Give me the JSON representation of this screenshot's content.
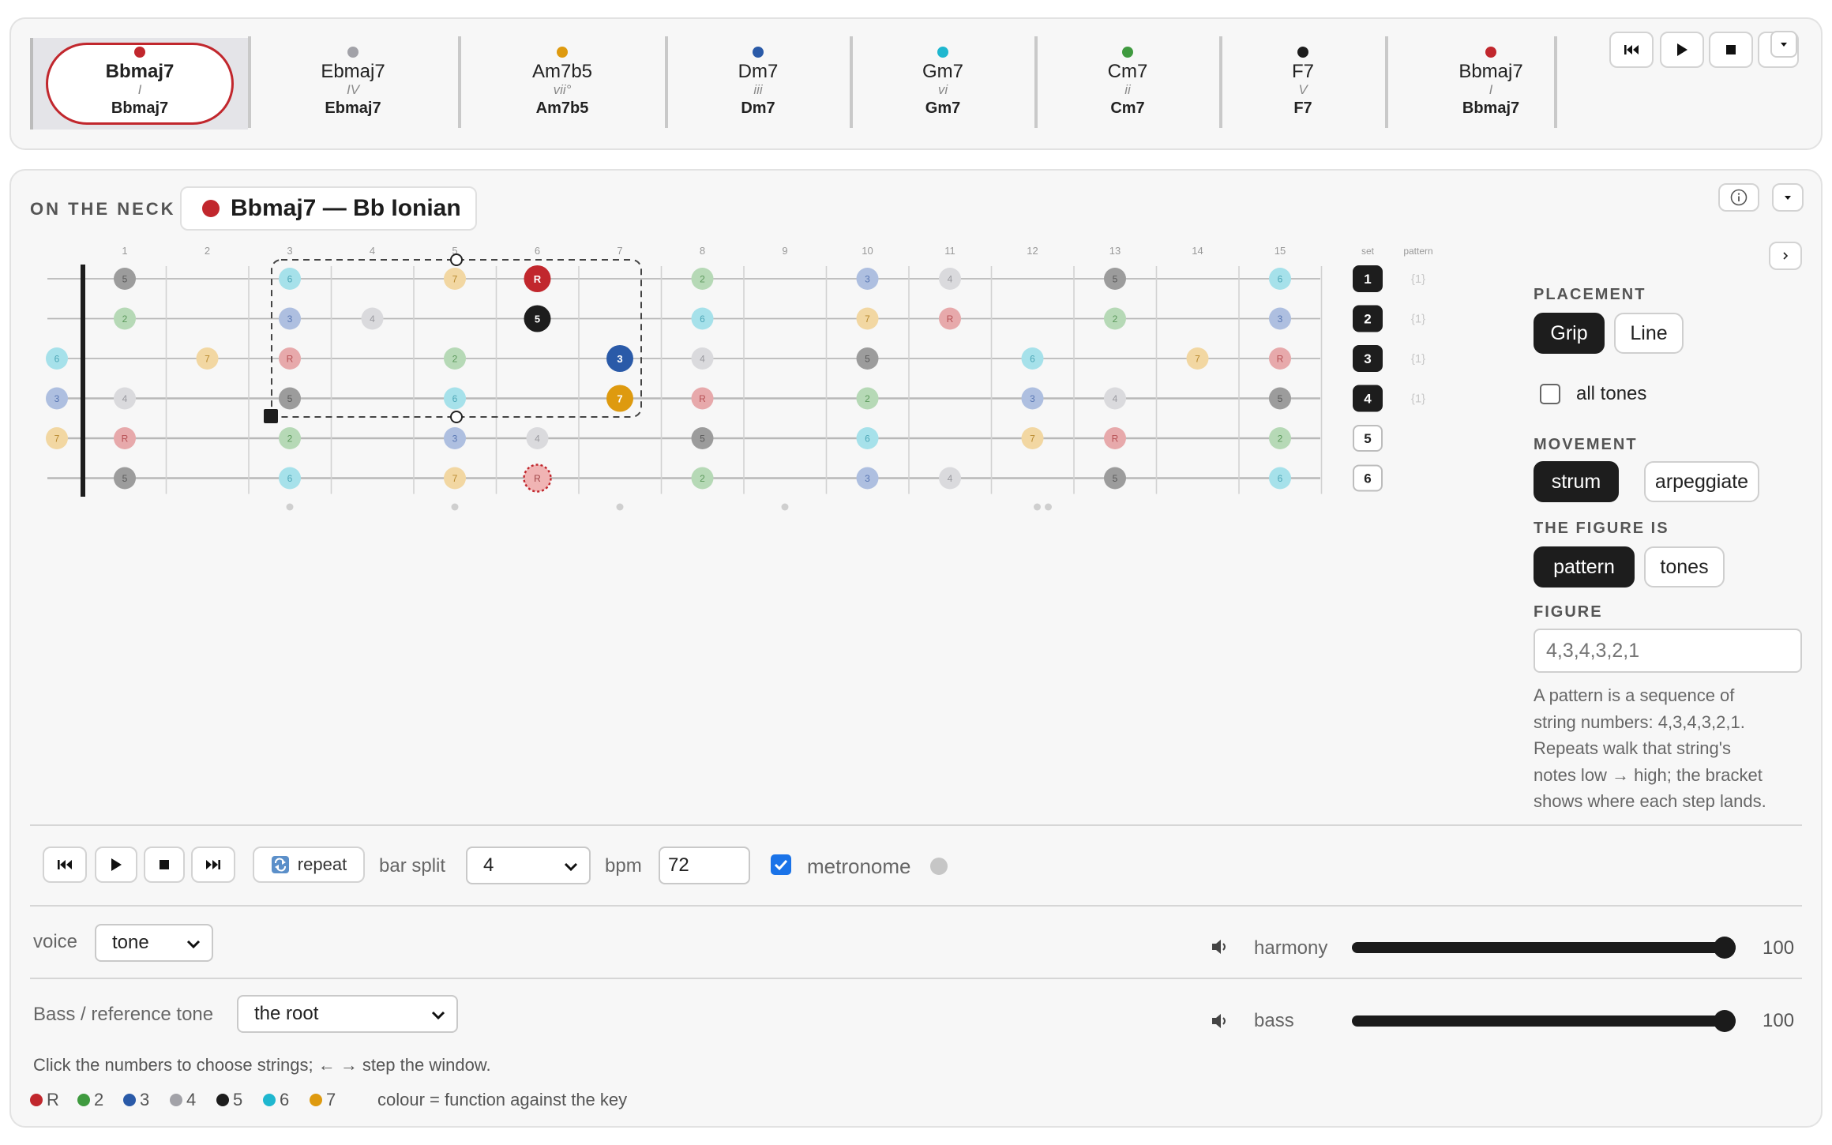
{
  "colors": {
    "R": "#c1272d",
    "2": "#3f9a3f",
    "3": "#2a5aa8",
    "4": "#a2a2a8",
    "5": "#1d1d1d",
    "6": "#1fb7cf",
    "7": "#de9a0f"
  },
  "progression": [
    {
      "name": "Bbmaj7",
      "roman": "I",
      "bass": "Bbmaj7",
      "color": "#c1272d",
      "selected": true
    },
    {
      "name": "Ebmaj7",
      "roman": "IV",
      "bass": "Ebmaj7",
      "color": "#a2a2a8"
    },
    {
      "name": "Am7b5",
      "roman": "vii°",
      "bass": "Am7b5",
      "color": "#de9a0f"
    },
    {
      "name": "Dm7",
      "roman": "iii",
      "bass": "Dm7",
      "color": "#2a5aa8"
    },
    {
      "name": "Gm7",
      "roman": "vi",
      "bass": "Gm7",
      "color": "#1fb7cf"
    },
    {
      "name": "Cm7",
      "roman": "ii",
      "bass": "Cm7",
      "color": "#3f9a3f"
    },
    {
      "name": "F7",
      "roman": "V",
      "bass": "F7",
      "color": "#1d1d1d"
    },
    {
      "name": "Bbmaj7",
      "roman": "I",
      "bass": "Bbmaj7",
      "color": "#c1272d"
    }
  ],
  "transport_top": [
    "skip-back-icon",
    "play-icon",
    "stop-icon",
    "collapse-icon"
  ],
  "neck": {
    "section_label": "ON THE NECK",
    "title": "Bbmaj7 — Bb Ionian",
    "title_color": "#c1272d",
    "fret_numbers": [
      "1",
      "2",
      "3",
      "4",
      "5",
      "6",
      "7",
      "8",
      "9",
      "10",
      "11",
      "12",
      "13",
      "14",
      "15"
    ],
    "col_set": "set",
    "col_pattern": "pattern",
    "set_strings": [
      {
        "n": "1",
        "on": true,
        "pattern": "{1}"
      },
      {
        "n": "2",
        "on": true,
        "pattern": "{1}"
      },
      {
        "n": "3",
        "on": true,
        "pattern": "{1}"
      },
      {
        "n": "4",
        "on": true,
        "pattern": "{1}"
      },
      {
        "n": "5",
        "on": false,
        "pattern": ""
      },
      {
        "n": "6",
        "on": false,
        "pattern": ""
      }
    ]
  },
  "sidebar": {
    "placement_label": "PLACEMENT",
    "placement_options": [
      "Grip",
      "Line"
    ],
    "all_tones_label": "all tones",
    "movement_label": "MOVEMENT",
    "movement_options": [
      "strum",
      "arpeggiate"
    ],
    "figure_is_label": "THE FIGURE IS",
    "figure_is_options": [
      "pattern",
      "tones"
    ],
    "figure_label": "FIGURE",
    "figure_placeholder": "4,3,4,3,2,1",
    "help_lines": [
      "A pattern is a sequence of",
      "string numbers: 4,3,4,3,2,1.",
      "Repeats walk that string's",
      "notes low → high; the bracket",
      "shows where each step lands."
    ]
  },
  "transport": {
    "repeat_label": "repeat",
    "bar_split_label": "bar split",
    "bar_split_value": "4",
    "bpm_label": "bpm",
    "bpm_value": "72",
    "metronome_label": "metronome"
  },
  "voice": {
    "label": "voice",
    "value": "tone"
  },
  "bass_ref": {
    "label": "Bass / reference tone",
    "value": "the root"
  },
  "mixer": [
    {
      "label": "harmony",
      "value": "100",
      "level": 1.0
    },
    {
      "label": "bass",
      "value": "100",
      "level": 1.0
    }
  ],
  "hint": "Click the numbers to choose strings; ← → step the window.",
  "legend": {
    "items": [
      "R",
      "2",
      "3",
      "4",
      "5",
      "6",
      "7"
    ],
    "caption": "colour = function against the key"
  }
}
